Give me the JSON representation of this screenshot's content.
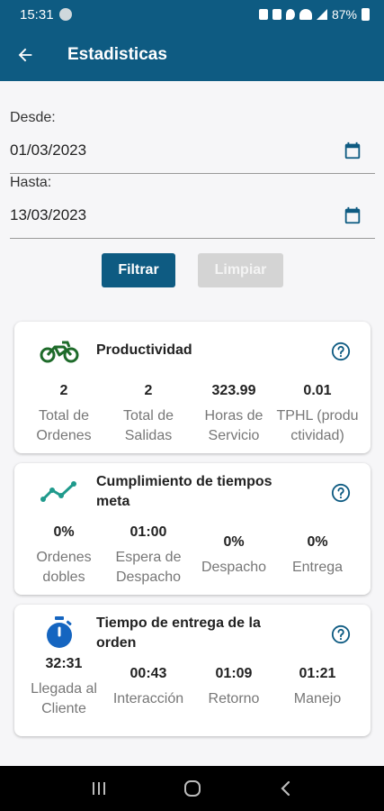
{
  "status": {
    "time": "15:31",
    "battery": "87%"
  },
  "header": {
    "title": "Estadisticas"
  },
  "filter": {
    "from_label": "Desde:",
    "from_value": "01/03/2023",
    "to_label": "Hasta:",
    "to_value": "13/03/2023",
    "filter_button": "Filtrar",
    "clear_button": "Limpiar"
  },
  "cards": [
    {
      "title": "Productividad",
      "icon": "motorcycle-icon",
      "metrics": [
        {
          "value": "2",
          "label": "Total de Ordenes"
        },
        {
          "value": "2",
          "label": "Total de Salidas"
        },
        {
          "value": "323.99",
          "label": "Horas de Servicio"
        },
        {
          "value": "0.01",
          "label": "TPHL (productividad)"
        }
      ]
    },
    {
      "title": "Cumplimiento de tiempos meta",
      "icon": "trend-line-icon",
      "metrics": [
        {
          "value": "0%",
          "label": "Ordenes dobles"
        },
        {
          "value": "01:00",
          "label": "Espera de Despacho"
        },
        {
          "value": "0%",
          "label": "Despacho"
        },
        {
          "value": "0%",
          "label": "Entrega"
        }
      ]
    },
    {
      "title": "Tiempo de entrega de la orden",
      "icon": "stopwatch-icon",
      "metrics": [
        {
          "value": "32:31",
          "label": "Llegada al Cliente"
        },
        {
          "value": "00:43",
          "label": "Interacción"
        },
        {
          "value": "01:09",
          "label": "Retorno"
        },
        {
          "value": "01:21",
          "label": "Manejo"
        }
      ]
    }
  ],
  "colors": {
    "primary": "#0e5b82",
    "moto": "#1e6b2a",
    "trend": "#1f9a8c",
    "stopwatch": "#1565c0"
  }
}
